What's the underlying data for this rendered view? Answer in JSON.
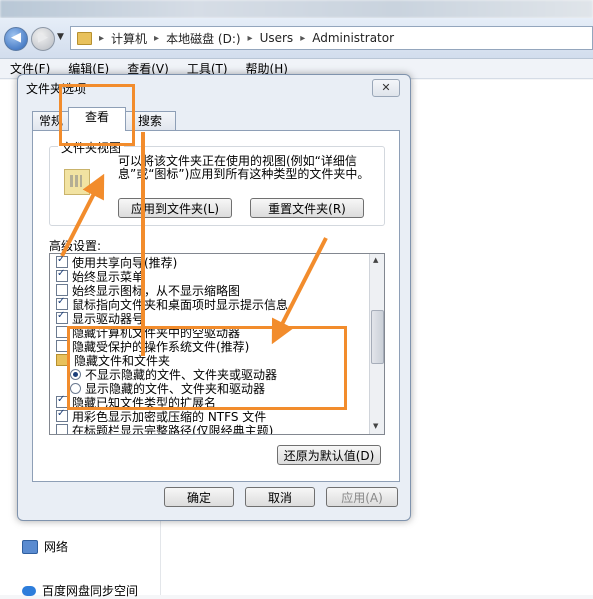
{
  "window": {
    "breadcrumb": [
      "计算机",
      "本地磁盘 (D:)",
      "Users",
      "Administrator"
    ],
    "menu": [
      "文件(F)",
      "编辑(E)",
      "查看(V)",
      "工具(T)",
      "帮助(H)"
    ]
  },
  "nav": {
    "items": [
      "网络",
      "百度网盘同步空间"
    ]
  },
  "dialog": {
    "title": "文件夹选项",
    "close": "✕",
    "tabs": [
      "常规",
      "查看",
      "搜索"
    ],
    "active_tab": "查看",
    "folder_view": {
      "legend": "文件夹视图",
      "description": "可以将该文件夹正在使用的视图(例如“详细信息”或“图标”)应用到所有这种类型的文件夹中。",
      "apply_button": "应用到文件夹(L)",
      "reset_button": "重置文件夹(R)"
    },
    "advanced_label": "高级设置:",
    "settings": [
      {
        "type": "checkbox",
        "checked": true,
        "label": "使用共享向导(推荐)"
      },
      {
        "type": "checkbox",
        "checked": true,
        "label": "始终显示菜单"
      },
      {
        "type": "checkbox",
        "checked": false,
        "label": "始终显示图标，从不显示缩略图"
      },
      {
        "type": "checkbox",
        "checked": true,
        "label": "鼠标指向文件夹和桌面项时显示提示信息"
      },
      {
        "type": "checkbox",
        "checked": true,
        "label": "显示驱动器号"
      },
      {
        "type": "checkbox",
        "checked": false,
        "label": "隐藏计算机文件夹中的空驱动器"
      },
      {
        "type": "checkbox",
        "checked": false,
        "label": "隐藏受保护的操作系统文件(推荐)"
      },
      {
        "type": "folder",
        "label": "隐藏文件和文件夹"
      },
      {
        "type": "radio",
        "checked": true,
        "label": "不显示隐藏的文件、文件夹或驱动器"
      },
      {
        "type": "radio",
        "checked": false,
        "label": "显示隐藏的文件、文件夹和驱动器"
      },
      {
        "type": "checkbox",
        "checked": true,
        "label": "隐藏已知文件类型的扩展名"
      },
      {
        "type": "checkbox",
        "checked": true,
        "label": "用彩色显示加密或压缩的 NTFS 文件"
      },
      {
        "type": "checkbox",
        "checked": false,
        "label": "在标题栏显示完整路径(仅限经典主题)"
      }
    ],
    "restore_button": "还原为默认值(D)",
    "ok_button": "确定",
    "cancel_button": "取消",
    "apply_button": "应用(A)"
  },
  "annotation_color": "#f28c2c"
}
